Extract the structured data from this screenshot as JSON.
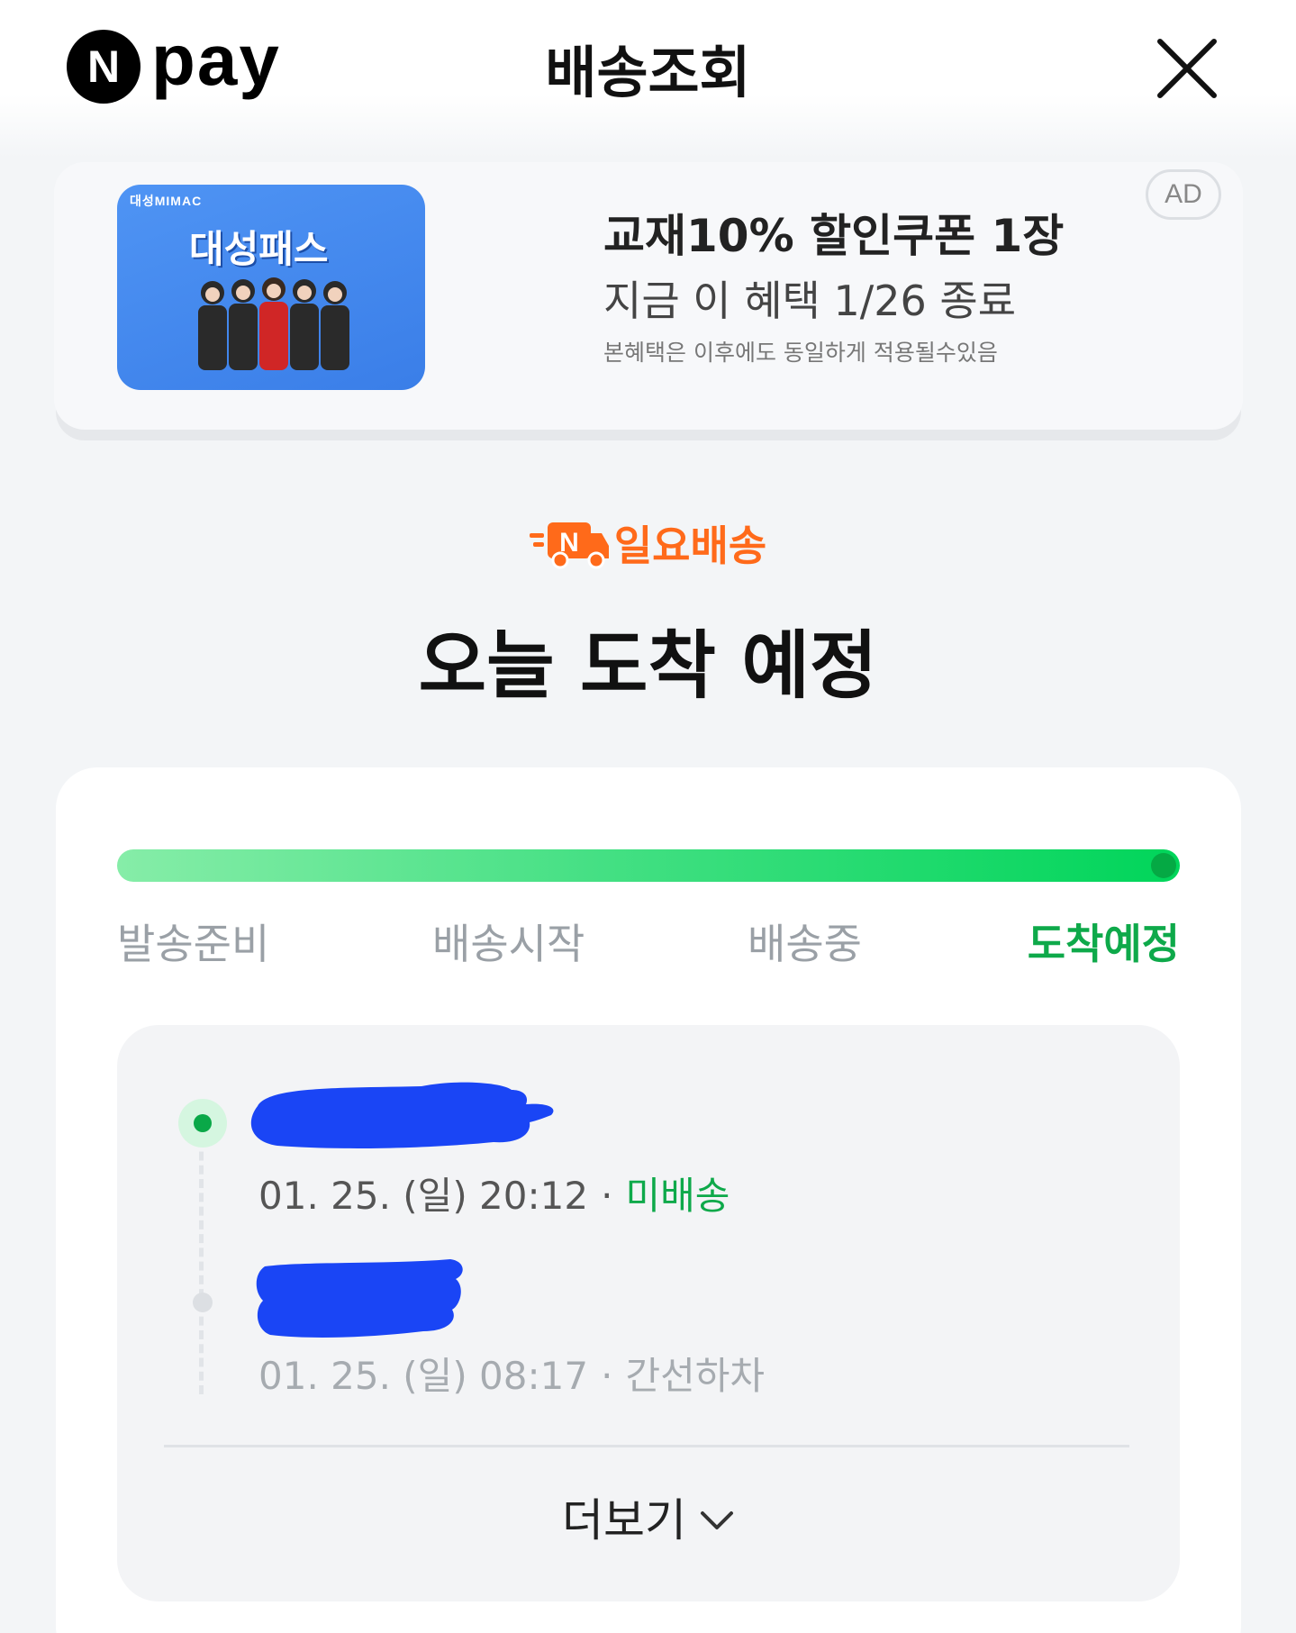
{
  "header": {
    "logo_letter": "N",
    "logo_text": "pay",
    "title": "배송조회",
    "close_icon": "close-icon"
  },
  "ad": {
    "image_small_text": "대성MIMAC",
    "image_title": "대성패스",
    "headline": "교재10% 할인쿠폰 1장",
    "subline": "지금 이 혜택 1/26 종료",
    "note": "본혜택은 이후에도 동일하게 적용될수있음",
    "badge": "AD"
  },
  "delivery": {
    "service_letter": "N",
    "service_label": "일요배송",
    "service_color": "#ff6a1a",
    "status_headline": "오늘 도착 예정"
  },
  "progress": {
    "percent": 100,
    "steps": [
      "발송준비",
      "배송시작",
      "배송중",
      "도착예정"
    ],
    "active_step": 3
  },
  "history": {
    "events": [
      {
        "date": "01. 25. (일) 20:12",
        "separator": "·",
        "status": "미배송",
        "current": true
      },
      {
        "date": "01. 25. (일) 08:17",
        "separator": "·",
        "status": "간선하차",
        "current": false
      }
    ],
    "more_label": "더보기"
  },
  "colors": {
    "accent_green": "#0ea94a",
    "redaction_blue": "#1a45f5"
  }
}
